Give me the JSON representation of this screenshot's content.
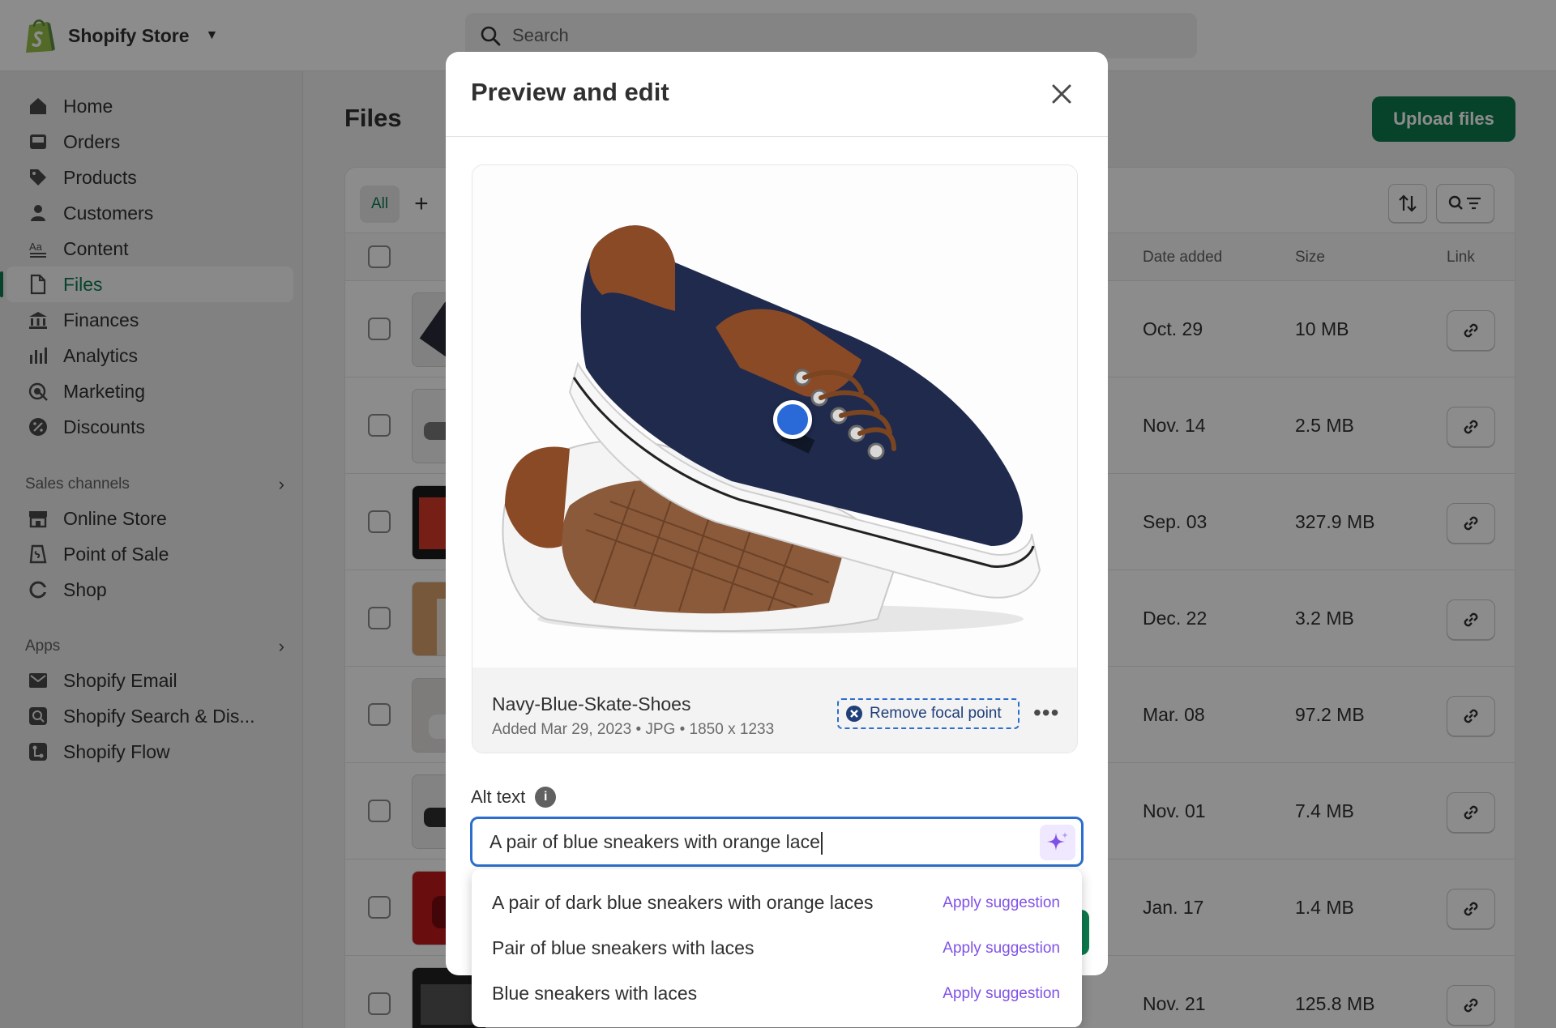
{
  "store": {
    "name": "Shopify Store"
  },
  "search": {
    "placeholder": "Search"
  },
  "sidebar": {
    "items": [
      {
        "label": "Home",
        "icon": "home-icon"
      },
      {
        "label": "Orders",
        "icon": "orders-icon"
      },
      {
        "label": "Products",
        "icon": "tag-icon"
      },
      {
        "label": "Customers",
        "icon": "person-icon"
      },
      {
        "label": "Content",
        "icon": "content-icon"
      },
      {
        "label": "Files",
        "icon": "file-icon",
        "active": true
      },
      {
        "label": "Finances",
        "icon": "bank-icon"
      },
      {
        "label": "Analytics",
        "icon": "bar-chart-icon"
      },
      {
        "label": "Marketing",
        "icon": "target-icon"
      },
      {
        "label": "Discounts",
        "icon": "discount-icon"
      }
    ],
    "sales_channels": {
      "heading": "Sales channels",
      "items": [
        {
          "label": "Online Store",
          "icon": "store-icon"
        },
        {
          "label": "Point of Sale",
          "icon": "pos-icon"
        },
        {
          "label": "Shop",
          "icon": "shop-icon"
        }
      ]
    },
    "apps": {
      "heading": "Apps",
      "items": [
        {
          "label": "Shopify Email",
          "icon": "email-icon"
        },
        {
          "label": "Shopify Search & Dis...",
          "icon": "search-app-icon"
        },
        {
          "label": "Shopify Flow",
          "icon": "flow-icon"
        }
      ]
    }
  },
  "main": {
    "title": "Files",
    "upload_label": "Upload files",
    "tab_all": "All",
    "tab_add": "+",
    "columns": {
      "date": "Date added",
      "size": "Size",
      "link": "Link"
    },
    "rows": [
      {
        "date": "Oct. 29",
        "size": "10 MB"
      },
      {
        "date": "Nov. 14",
        "size": "2.5 MB"
      },
      {
        "date": "Sep. 03",
        "size": "327.9 MB"
      },
      {
        "date": "Dec. 22",
        "size": "3.2 MB"
      },
      {
        "date": "Mar. 08",
        "size": "97.2 MB"
      },
      {
        "date": "Nov. 01",
        "size": "7.4 MB"
      },
      {
        "date": "Jan. 17",
        "size": "1.4 MB"
      },
      {
        "date": "Nov. 21",
        "size": "125.8 MB"
      }
    ]
  },
  "modal": {
    "title": "Preview and edit",
    "file_name": "Navy-Blue-Skate-Shoes",
    "file_meta": "Added Mar 29, 2023 • JPG • 1850 x 1233",
    "remove_focal": "Remove focal point",
    "more": "•••",
    "alt_label": "Alt text",
    "alt_value": "A pair of blue sneakers with orange lace",
    "suggestions": [
      {
        "text": "A pair of dark blue sneakers with orange laces",
        "action": "Apply suggestion"
      },
      {
        "text": "Pair of blue sneakers with laces",
        "action": "Apply suggestion"
      },
      {
        "text": "Blue sneakers with laces",
        "action": "Apply suggestion"
      }
    ]
  },
  "colors": {
    "brand_green": "#0d7a4d",
    "focus_blue": "#2c6ecb",
    "focal_point": "#2a6ad8",
    "ai_purple": "#8051e6"
  }
}
